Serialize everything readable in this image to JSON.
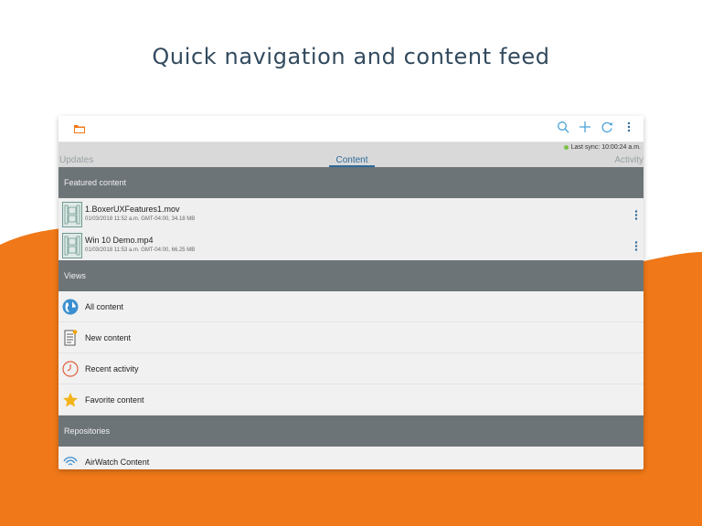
{
  "headline": "Quick navigation and content feed",
  "colors": {
    "accent": "#f07818",
    "section": "#6d7478",
    "tab_active": "#2d6a99"
  },
  "appbar": {
    "logo_icon": "folder-icon",
    "actions": [
      "search-icon",
      "add-icon",
      "sync-icon",
      "more-vert-icon"
    ]
  },
  "tabs": {
    "sync_status": "Last sync: 10:00:24 a.m.",
    "items": [
      "Updates",
      "Content",
      "Activity"
    ],
    "active": "Content"
  },
  "featured": {
    "header": "Featured content",
    "files": [
      {
        "name": "1.BoxerUXFeatures1.mov",
        "meta": "01/03/2018  11:52 a.m. GMT-04:00, 34.18 MB"
      },
      {
        "name": "Win 10 Demo.mp4",
        "meta": "01/03/2018  11:53 a.m. GMT-04:00, 66.25 MB"
      }
    ]
  },
  "views": {
    "header": "Views",
    "items": [
      {
        "label": "All content",
        "icon": "globe-icon"
      },
      {
        "label": "New content",
        "icon": "new-document-icon"
      },
      {
        "label": "Recent activity",
        "icon": "clock-icon"
      },
      {
        "label": "Favorite content",
        "icon": "star-icon"
      }
    ]
  },
  "repositories": {
    "header": "Repositories",
    "items": [
      {
        "label": "AirWatch Content",
        "icon": "airwatch-icon"
      }
    ]
  }
}
